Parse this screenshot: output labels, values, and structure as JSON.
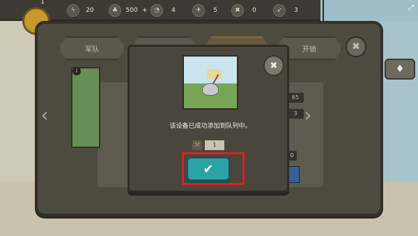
{
  "top_bar": {
    "level": "1",
    "resources": [
      {
        "icon": "lightning-icon",
        "glyph": "ϟ",
        "value": "20"
      },
      {
        "icon": "coin-icon",
        "glyph": "♣",
        "value": "500"
      },
      {
        "icon": "timer-icon",
        "glyph": "◔",
        "value": "4"
      },
      {
        "icon": "plane-icon",
        "glyph": "✈",
        "value": "5"
      },
      {
        "icon": "cross-icon",
        "glyph": "✖",
        "value": "0"
      },
      {
        "icon": "rocket-icon",
        "glyph": "➶",
        "value": "3"
      }
    ],
    "coin_suffix": "+"
  },
  "tabs": [
    {
      "label": "军队"
    },
    {
      "label": ""
    },
    {
      "label": ""
    },
    {
      "label": "开锁"
    }
  ],
  "stats": {
    "value1": "65",
    "value2": "3",
    "value3": "0"
  },
  "modal": {
    "message": "该设备已成功添加到队列中。",
    "quantity": "1"
  },
  "colors": {
    "ok_button": "#2aa2a6",
    "highlight": "#d42424"
  }
}
